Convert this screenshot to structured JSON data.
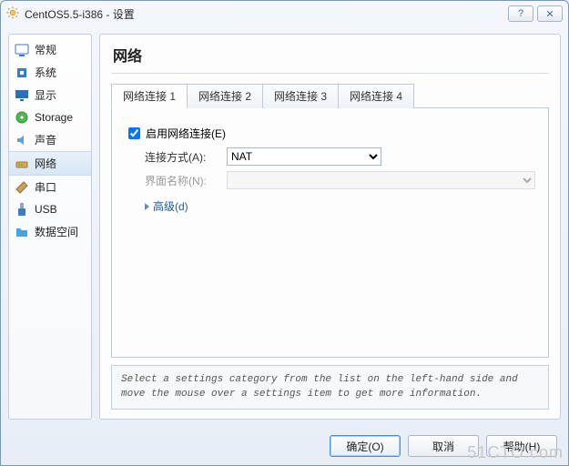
{
  "title": "CentOS5.5-i386 - 设置",
  "sidebar": {
    "items": [
      {
        "label": "常规"
      },
      {
        "label": "系统"
      },
      {
        "label": "显示"
      },
      {
        "label": "Storage"
      },
      {
        "label": "声音"
      },
      {
        "label": "网络"
      },
      {
        "label": "串口"
      },
      {
        "label": "USB"
      },
      {
        "label": "数据空间"
      }
    ],
    "selected_index": 5
  },
  "main": {
    "heading": "网络",
    "tabs": [
      {
        "label": "网络连接 1"
      },
      {
        "label": "网络连接 2"
      },
      {
        "label": "网络连接 3"
      },
      {
        "label": "网络连接 4"
      }
    ],
    "active_tab": 0,
    "enable_checkbox": {
      "checked": true,
      "label": "启用网络连接(E)"
    },
    "attach_label": "连接方式(A):",
    "attach_value": "NAT",
    "iface_label": "界面名称(N):",
    "iface_value": "",
    "advanced_label": "高级(d)",
    "hint": "Select a settings category from the list on the left-hand side and move the mouse over a settings item to get more information."
  },
  "footer": {
    "ok": "确定(O)",
    "cancel": "取消",
    "help": "帮助(H)"
  },
  "watermark": "51CTO.com"
}
